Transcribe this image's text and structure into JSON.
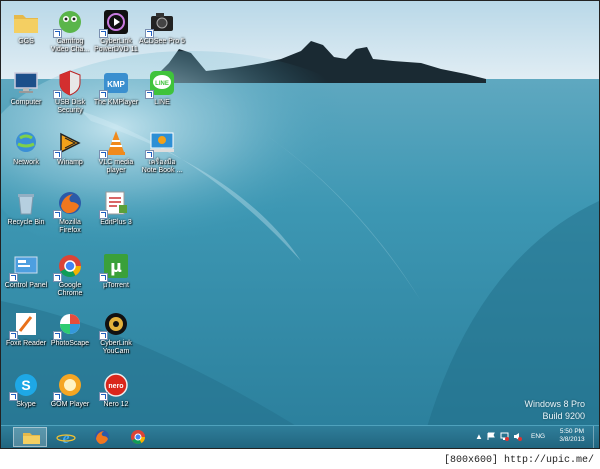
{
  "desktop": {
    "icons": [
      {
        "label": "GGS",
        "icon": "folder-icon"
      },
      {
        "label": "Camfrog\nVideo Cha...",
        "icon": "camfrog-icon"
      },
      {
        "label": "CyberLink\nPowerDVD 11",
        "icon": "powerdvd-icon"
      },
      {
        "label": "ACDSee Pro 5",
        "icon": "camera-icon"
      },
      {
        "label": "Computer",
        "icon": "computer-icon"
      },
      {
        "label": "USB Disk\nSecurity",
        "icon": "shield-icon"
      },
      {
        "label": "The KMPlayer",
        "icon": "kmplayer-icon"
      },
      {
        "label": "LINE",
        "icon": "line-icon"
      },
      {
        "label": "Network",
        "icon": "network-icon"
      },
      {
        "label": "Winamp",
        "icon": "winamp-icon"
      },
      {
        "label": "VLC media\nplayer",
        "icon": "vlc-icon"
      },
      {
        "label": "เครื่องมือ\nNote Book ...",
        "icon": "notebook-icon"
      },
      {
        "label": "Recycle Bin",
        "icon": "recycle-bin-icon"
      },
      {
        "label": "Mozilla\nFirefox",
        "icon": "firefox-icon"
      },
      {
        "label": "EditPlus 3",
        "icon": "editplus-icon"
      },
      {
        "label": "Control Panel",
        "icon": "control-panel-icon"
      },
      {
        "label": "Google\nChrome",
        "icon": "chrome-icon"
      },
      {
        "label": "µTorrent",
        "icon": "utorrent-icon"
      },
      {
        "label": "Foxit Reader",
        "icon": "foxit-icon"
      },
      {
        "label": "PhotoScape",
        "icon": "photoscape-icon"
      },
      {
        "label": "CyberLink\nYouCam",
        "icon": "youcam-icon"
      },
      {
        "label": "Skype",
        "icon": "skype-icon"
      },
      {
        "label": "GOM Player",
        "icon": "gom-icon"
      },
      {
        "label": "Nero 12",
        "icon": "nero-icon"
      }
    ],
    "watermark": {
      "line1": "Windows 8 Pro",
      "line2": "Build 9200"
    }
  },
  "taskbar": {
    "pinned": [
      {
        "name": "file-explorer",
        "icon": "folder-icon"
      },
      {
        "name": "internet-explorer",
        "icon": "ie-icon"
      },
      {
        "name": "firefox",
        "icon": "firefox-icon"
      },
      {
        "name": "chrome",
        "icon": "chrome-icon"
      }
    ],
    "tray": {
      "language": "ENG",
      "time": "5:50 PM",
      "date": "3/8/2013"
    }
  },
  "caption": "[800x600] http://upic.me/",
  "colors": {
    "taskbar": "#2a7590",
    "sea": "#3a9bb8",
    "sky": "#cfe6f1"
  }
}
